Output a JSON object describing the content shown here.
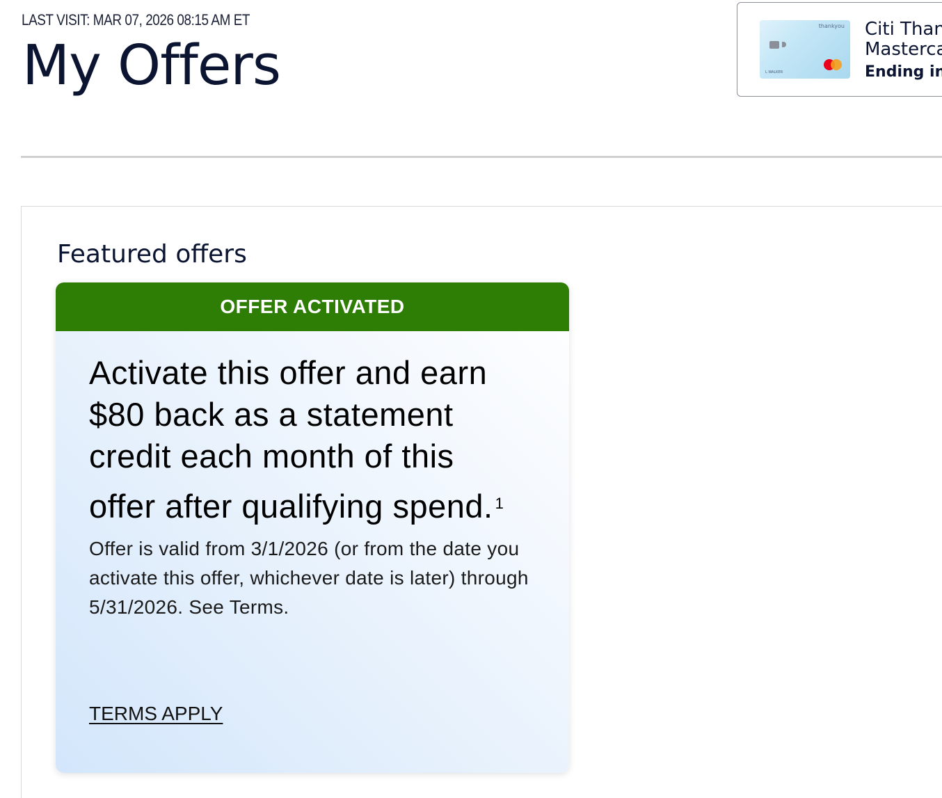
{
  "header": {
    "last_visit": "LAST VISIT: MAR 07, 2026 08:15 AM ET",
    "title": "My Offers"
  },
  "card_selector": {
    "card_name": "Citi Thank\nMasterca",
    "ending_label": "Ending in",
    "card_art": {
      "brand_text": "thankyou",
      "holder_text": "L WALKER",
      "network": "mastercard-logo"
    }
  },
  "featured": {
    "heading": "Featured offers",
    "offer": {
      "status_banner": "OFFER ACTIVATED",
      "headline_lines": [
        "Activate this offer and earn",
        "$80 back as a statement",
        "credit each month of this",
        "offer after qualifying spend."
      ],
      "footnote_marker": "1",
      "details": "Offer is valid from 3/1/2026 (or from the date you activate this offer, whichever date is later) through 5/31/2026. See Terms.",
      "terms_link": "TERMS APPLY"
    }
  },
  "colors": {
    "title_navy": "#0b1532",
    "banner_green": "#2e7d05",
    "tile_gradient_light": "#ffffff",
    "tile_gradient_blue": "#d3e6fb",
    "divider": "#d0d0d0"
  }
}
